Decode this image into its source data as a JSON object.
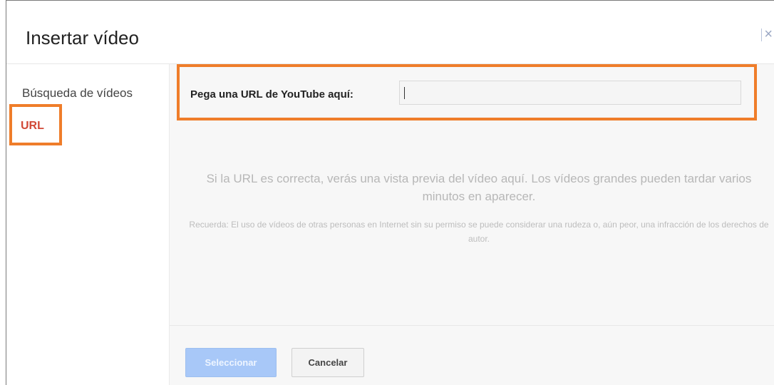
{
  "dialog": {
    "title": "Insertar vídeo",
    "close_label": "×"
  },
  "sidebar": {
    "items": [
      {
        "label": "Búsqueda de vídeos",
        "selected": false
      },
      {
        "label": "URL",
        "selected": true
      }
    ]
  },
  "url_field": {
    "label": "Pega una URL de YouTube aquí:",
    "value": ""
  },
  "preview": {
    "hint": "Si la URL es correcta, verás una vista previa del vídeo aquí. Los vídeos grandes pueden tardar varios minutos en aparecer.",
    "note": "Recuerda: El uso de vídeos de otras personas en Internet sin su permiso se puede considerar una rudeza o, aún peor, una infracción de los derechos de autor."
  },
  "buttons": {
    "select": "Seleccionar",
    "cancel": "Cancelar"
  },
  "colors": {
    "highlight": "#ef7d2a",
    "selected_nav": "#d14836",
    "primary_disabled": "#a8c8f8"
  }
}
